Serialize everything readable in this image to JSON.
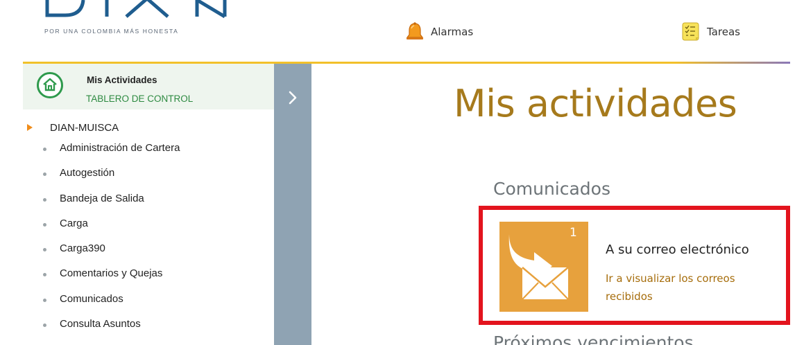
{
  "header": {
    "logo_alt": "DIAN",
    "tagline": "POR UNA COLOMBIA MÁS HONESTA",
    "alarmas_label": "Alarmas",
    "tareas_label": "Tareas",
    "alarmas_icon": "bell-icon",
    "tareas_icon": "task-list-icon"
  },
  "sidebar": {
    "title": "Mis Actividades",
    "subtitle": "TABLERO DE CONTROL",
    "home_icon": "home-icon",
    "tree_root": "DIAN-MUISCA",
    "items": [
      {
        "label": "Administración de Cartera"
      },
      {
        "label": "Autogestión"
      },
      {
        "label": "Bandeja de Salida"
      },
      {
        "label": "Carga"
      },
      {
        "label": "Carga390"
      },
      {
        "label": "Comentarios y Quejas"
      },
      {
        "label": "Comunicados"
      },
      {
        "label": "Consulta Asuntos"
      }
    ]
  },
  "collapse": {
    "icon": "chevron-right-icon"
  },
  "main": {
    "title": "Mis actividades",
    "section_title": "Comunicados",
    "card": {
      "badge_count": "1",
      "icon": "mail-forward-icon",
      "title": "A su correo electrónico",
      "link": "Ir a visualizar los correos recibidos"
    },
    "next_section_title": "Próximos vencimientos"
  },
  "colors": {
    "accent_gold": "#a67a1c",
    "tile_orange": "#e7a13d",
    "highlight_red": "#e3141e",
    "sidebar_green": "#2d8a41",
    "collapse_bar": "#8fa3b3"
  }
}
